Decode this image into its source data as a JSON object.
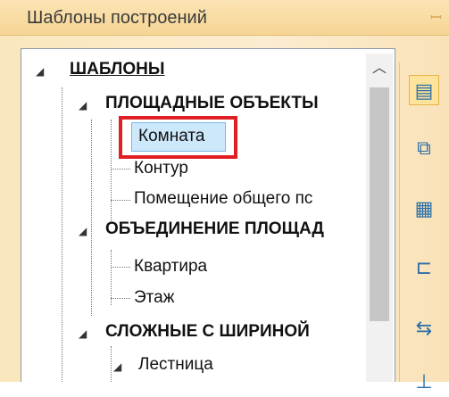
{
  "panel": {
    "title": "Шаблоны построений",
    "pin_icon": "pin-icon"
  },
  "tree": {
    "root": "ШАБЛОНЫ",
    "groups": [
      {
        "label": "ПЛОЩАДНЫЕ ОБЪЕКТЫ",
        "items": [
          "Комната",
          "Контур",
          "Помещение общего пс"
        ]
      },
      {
        "label": "ОБЪЕДИНЕНИЕ ПЛОЩАД",
        "items": [
          "Квартира",
          "Этаж"
        ]
      },
      {
        "label": "СЛОЖНЫЕ С ШИРИНОЙ",
        "items": [
          "Лестница"
        ]
      }
    ],
    "selected_item": "Комната"
  },
  "toolbar": {
    "icons": [
      "template-icon",
      "s-shape-icon",
      "grid-icon",
      "bracket-icon",
      "arrows-icon",
      "partial-icon"
    ]
  },
  "colors": {
    "title_bg": "#f6d595",
    "selection_outline": "#e01e24",
    "selection_fill": "#cde8fb"
  }
}
